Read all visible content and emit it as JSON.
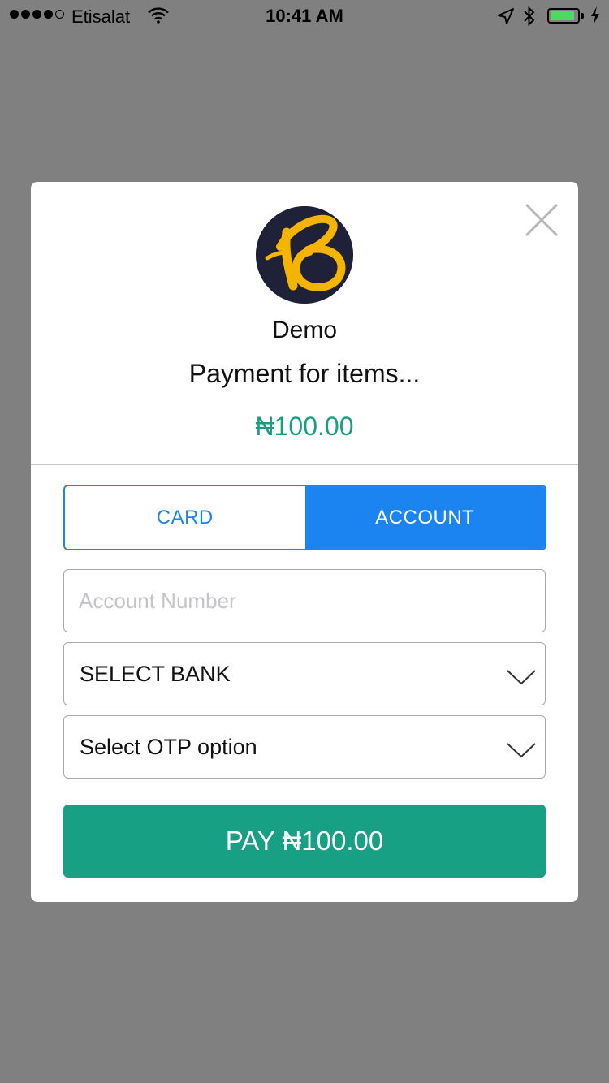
{
  "status_bar": {
    "carrier": "Etisalat",
    "time": "10:41 AM",
    "signal_bars": 4,
    "signal_total": 5,
    "battery_level": 0.9,
    "battery_color": "#4cd964"
  },
  "modal": {
    "merchant_name": "Demo",
    "description": "Payment for items...",
    "amount": "₦100.00",
    "accent_color": "#1a9e82",
    "tabs": [
      {
        "label": "CARD",
        "active": false
      },
      {
        "label": "ACCOUNT",
        "active": true
      }
    ],
    "tab_accent": "#1b84f0",
    "account_number": {
      "value": "",
      "placeholder": "Account Number"
    },
    "bank_select": {
      "selected": "SELECT BANK"
    },
    "otp_select": {
      "selected": "Select OTP option"
    },
    "pay_button": {
      "label": "PAY ₦100.00",
      "color": "#18a084"
    },
    "icons": {
      "close": "close-icon",
      "logo": "merchant-logo",
      "dropdown": "chevron-down-icon"
    }
  }
}
